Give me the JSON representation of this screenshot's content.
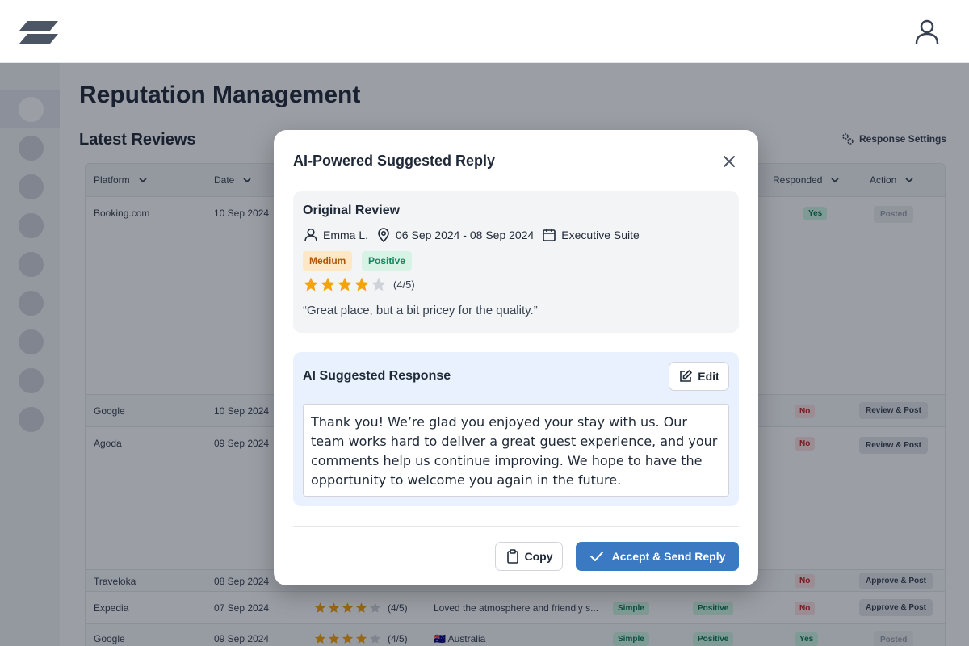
{
  "page": {
    "title": "Reputation Management",
    "section_title": "Latest Reviews",
    "response_settings_label": "Response Settings"
  },
  "table": {
    "columns": [
      "Platform",
      "Date",
      "Responded",
      "Action"
    ],
    "rows": [
      {
        "platform": "Booking.com",
        "date": "10 Sep 2024",
        "responded": "Yes",
        "action": "Posted"
      },
      {
        "platform": "Google",
        "date": "10 Sep 2024",
        "responded": "No",
        "action": "Review & Post"
      },
      {
        "platform": "Agoda",
        "date": "09 Sep 2024",
        "responded": "No",
        "action": "Review & Post"
      },
      {
        "platform": "Traveloka",
        "date": "08 Sep 2024",
        "responded": "No",
        "action": "Approve & Post"
      },
      {
        "platform": "Expedia",
        "date": "07 Sep 2024",
        "rating_text": "(4/5)",
        "review": "Loved the atmosphere and friendly s...",
        "complexity": "Simple",
        "sentiment": "Positive",
        "responded": "No",
        "action": "Approve & Post"
      },
      {
        "platform": "Google",
        "date": "09 Sep 2024",
        "rating_text": "(4/5)",
        "review": "🇦🇺 Australia",
        "complexity": "Simple",
        "sentiment": "Positive",
        "responded": "Yes",
        "action": "Posted"
      }
    ]
  },
  "modal": {
    "title": "AI-Powered Suggested Reply",
    "original": {
      "title": "Original Review",
      "guest": "Emma L.",
      "dates": "06 Sep 2024 - 08 Sep 2024",
      "room": "Executive Suite",
      "tags": {
        "complexity": "Medium",
        "sentiment": "Positive"
      },
      "rating": 4,
      "rating_max": 5,
      "rating_text": "(4/5)",
      "quote": "“Great place, but a bit pricey for the quality.”"
    },
    "ai": {
      "title": "AI Suggested Response",
      "edit_label": "Edit",
      "response": "Thank you! We’re glad you enjoyed your stay with us. Our team works hard to deliver a great guest experience, and your comments help us continue improving. We hope to have the opportunity to welcome you again in the future."
    },
    "copy_label": "Copy",
    "accept_label": "Accept & Send Reply"
  },
  "colors": {
    "star": "#f5a30a",
    "star_empty": "#cfd3d9",
    "primary": "#3b7ac3",
    "overlay": "rgba(17,24,39,0.42)"
  }
}
